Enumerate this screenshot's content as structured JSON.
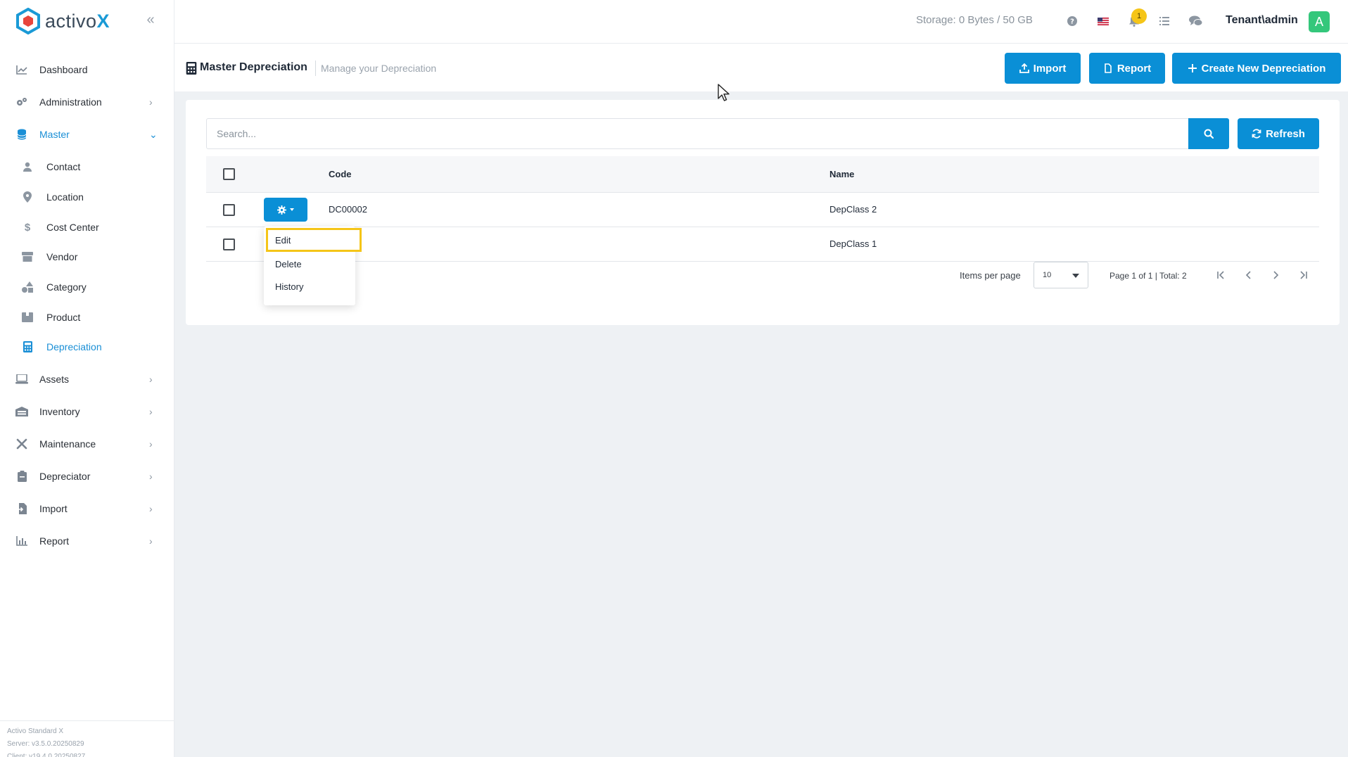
{
  "app": {
    "brand_prefix": "activo",
    "brand_suffix": "X"
  },
  "topbar": {
    "storage": "Storage: 0 Bytes / 50 GB",
    "notifications_count": "1",
    "user": "Tenant\\admin",
    "avatar_letter": "A"
  },
  "sidebar": {
    "items": [
      {
        "label": "Dashboard",
        "icon": "chart-line-icon"
      },
      {
        "label": "Administration",
        "icon": "gears-icon"
      },
      {
        "label": "Master",
        "icon": "database-icon"
      },
      {
        "label": "Assets",
        "icon": "laptop-icon"
      },
      {
        "label": "Inventory",
        "icon": "warehouse-icon"
      },
      {
        "label": "Maintenance",
        "icon": "tools-icon"
      },
      {
        "label": "Depreciator",
        "icon": "clipboard-icon"
      },
      {
        "label": "Import",
        "icon": "file-import-icon"
      },
      {
        "label": "Report",
        "icon": "bar-chart-icon"
      }
    ],
    "master_sub": [
      {
        "label": "Contact",
        "icon": "user-icon"
      },
      {
        "label": "Location",
        "icon": "map-pin-icon"
      },
      {
        "label": "Cost Center",
        "icon": "dollar-icon"
      },
      {
        "label": "Vendor",
        "icon": "store-icon"
      },
      {
        "label": "Category",
        "icon": "shapes-icon"
      },
      {
        "label": "Product",
        "icon": "box-icon"
      },
      {
        "label": "Depreciation",
        "icon": "calculator-icon"
      }
    ],
    "footer": {
      "product": "Activo Standard X",
      "server": "Server: v3.5.0.20250829",
      "client": "Client: v19.4.0.20250827"
    }
  },
  "page": {
    "title": "Master Depreciation",
    "subtitle": "Manage your Depreciation",
    "buttons": {
      "import": "Import",
      "report": "Report",
      "create": "Create New Depreciation"
    }
  },
  "search": {
    "placeholder": "Search...",
    "refresh": "Refresh"
  },
  "table": {
    "columns": {
      "code": "Code",
      "name": "Name"
    },
    "rows": [
      {
        "code": "DC00002",
        "name": "DepClass 2"
      },
      {
        "code": "DC00001",
        "code_visible": "01",
        "name": "DepClass 1"
      }
    ]
  },
  "row_menu": {
    "items": [
      "Edit",
      "Delete",
      "History"
    ]
  },
  "pager": {
    "items_per_page_label": "Items per page",
    "items_per_page": "10",
    "info": "Page 1 of 1 | Total: 2"
  },
  "colors": {
    "primary": "#0a8fd6",
    "highlight": "#f5c518",
    "avatar": "#34c77b"
  }
}
